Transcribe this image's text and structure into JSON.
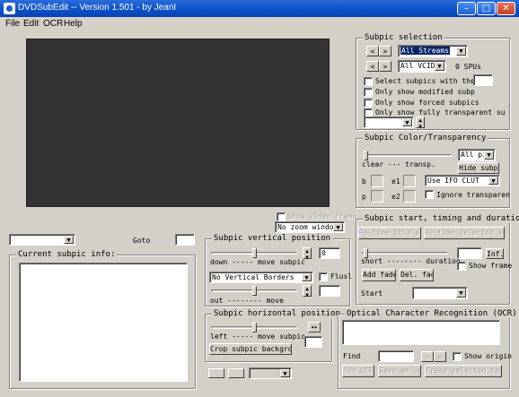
{
  "window": {
    "title": "DVDSubEdit -- Version 1.501 - by JeanI",
    "min": "–",
    "max": "□",
    "close": "✕"
  },
  "menu": [
    "File",
    "Edit",
    "OCR",
    "Help"
  ],
  "subpic_selection": {
    "title": "Subpic selection",
    "prev": "<",
    "next": ">",
    "stream": "All Streams",
    "vcid": "All VCID",
    "spu_count": "0 SPUs",
    "select_with_these": "Select subpics with these",
    "only_modified": "Only show modified subp",
    "only_forced": "Only show forced subpics",
    "only_transparent": "Only show fully transparent su"
  },
  "color_transparency": {
    "title": "Subpic Color/Transparency",
    "slider_label": "clear --- transp.",
    "all_pix": "All pix",
    "hide_subpic": "Hide subpic",
    "b": "b",
    "e1": "e1",
    "p": "p",
    "e2": "e2",
    "clut": "Use IFO CLUT",
    "ignore_transparent": "Ignore transparen"
  },
  "show_video_frame": "Show Video Frame",
  "zoom": "No zoom window",
  "goto": "Goto",
  "current_info": "Current subpic info:",
  "vertical": {
    "title": "Subpic vertical position",
    "down_label": "down ----- move subpic",
    "value": "0",
    "borders": "No Vertical Borders",
    "flush": "Flusl",
    "out_label": "out -------- move"
  },
  "horizontal": {
    "title": "Subpic horizontal position",
    "left_label": "left ----- move subpic",
    "crop": "Crop subpic background"
  },
  "timing": {
    "title": "Subpic start, timing and duration",
    "retime_subpic": "Re-time this subpic",
    "retime_selected": "Re-time selected subpic",
    "duration_label": "short -------- duration",
    "inf": "Inf.",
    "show_frame": "Show frame",
    "add_fade": "Add fade",
    "del_fade": "Del. fade",
    "start": "Start"
  },
  "ocr": {
    "title": "Optical Character Recognition (OCR)",
    "find": "Find",
    "show_origin": "Show origin",
    "run": "Run OCR",
    "save_as": "Save as .srt",
    "erase": "Erase selected text"
  }
}
